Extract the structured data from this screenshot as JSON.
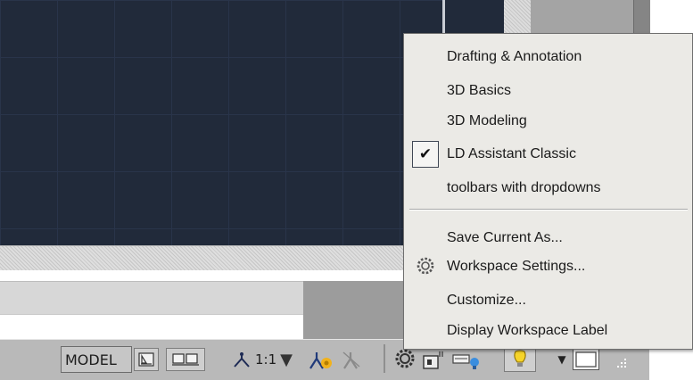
{
  "workspace_menu": {
    "items": [
      {
        "label": "Drafting & Annotation",
        "checked": false
      },
      {
        "label": "3D Basics",
        "checked": false
      },
      {
        "label": "3D Modeling",
        "checked": false
      },
      {
        "label": "LD Assistant Classic",
        "checked": true
      },
      {
        "label": "toolbars with dropdowns",
        "checked": false
      }
    ],
    "actions": [
      {
        "label": "Save Current As...",
        "icon": null
      },
      {
        "label": "Workspace Settings...",
        "icon": "gear-icon"
      },
      {
        "label": "Customize...",
        "icon": null
      },
      {
        "label": "Display Workspace Label",
        "icon": null
      }
    ],
    "check_glyph": "✔"
  },
  "status_bar": {
    "model_label": "MODEL",
    "annotation_scale": "1:1",
    "scale_dropdown_glyph": "▼"
  },
  "colors": {
    "canvas_background": "#212a3a",
    "menu_background": "#ebeae6",
    "status_bar_background": "#b9b9b9"
  }
}
